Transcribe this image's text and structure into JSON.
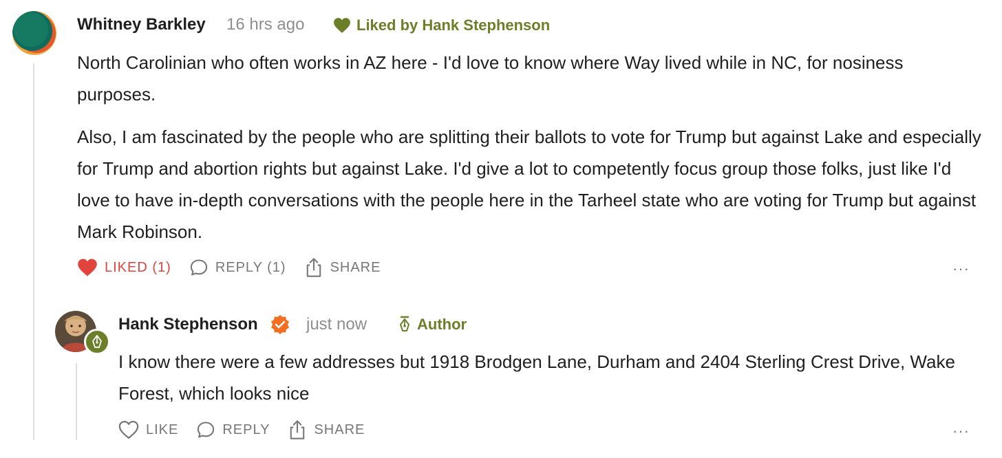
{
  "comments": [
    {
      "author": "Whitney Barkley",
      "time": "16 hrs ago",
      "badge": "Liked by Hank Stephenson",
      "paragraphs": [
        "North Carolinian who often works in AZ here - I'd love to know where Way lived while in NC, for nosiness purposes.",
        "Also, I am fascinated by the people who are splitting their ballots to vote for Trump but against Lake and especially for Trump and abortion rights but against Lake. I'd give a lot to competently focus group those folks, just like I'd love to have in-depth conversations with the people here in the Tarheel state who are voting for Trump but against Mark Robinson."
      ],
      "actions": {
        "like": "LIKED (1)",
        "reply": "REPLY (1)",
        "share": "SHARE"
      },
      "more": "···",
      "liked": true
    },
    {
      "author": "Hank Stephenson",
      "time": "just now",
      "badge": "Author",
      "verified": true,
      "paragraphs": [
        "I know there were a few addresses but 1918 Brodgen Lane, Durham and 2404 Sterling Crest Drive, Wake Forest, which looks nice"
      ],
      "actions": {
        "like": "LIKE",
        "reply": "REPLY",
        "share": "SHARE"
      },
      "more": "···",
      "liked": false
    }
  ],
  "colors": {
    "badge_green": "#6c7f28",
    "liked_red": "#e0443c",
    "verified_orange": "#f26e21",
    "muted_gray": "#777777"
  },
  "icons": {
    "liked_badge": "heart-icon",
    "author_badge": "fountain-pen-icon",
    "verified": "checkmark-badge-icon",
    "like": "heart-icon",
    "reply": "speech-bubble-icon",
    "share": "share-icon",
    "more": "ellipsis-icon"
  }
}
